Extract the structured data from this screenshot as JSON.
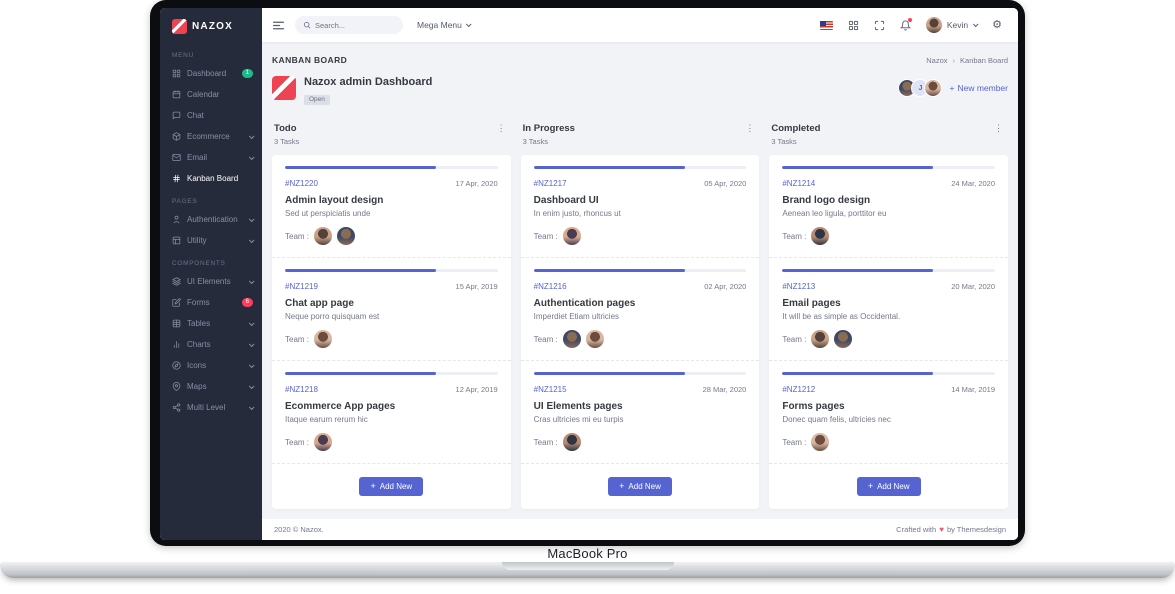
{
  "device_label": "MacBook Pro",
  "brand": "NAZOX",
  "colors": {
    "primary": "#5664d2",
    "sidebar_bg": "#252b3b",
    "success": "#1cbb8c",
    "danger": "#ff3d60",
    "logo_red": "#ee4352"
  },
  "icons": {
    "plus": "+",
    "vertical_dots": "⋮",
    "heart": "♥",
    "breadcrumb_separator": "›",
    "gear": "⚙"
  },
  "sidebar": {
    "sections": [
      {
        "label": "MENU",
        "items": [
          {
            "label": "Dashboard",
            "icon": "dashboard",
            "badge": "1",
            "badge_color": "#1cbb8c"
          },
          {
            "label": "Calendar",
            "icon": "calendar"
          },
          {
            "label": "Chat",
            "icon": "chat"
          },
          {
            "label": "Ecommerce",
            "icon": "ecommerce",
            "chevron": true
          },
          {
            "label": "Email",
            "icon": "email",
            "chevron": true
          },
          {
            "label": "Kanban Board",
            "icon": "kanban",
            "active": true
          }
        ]
      },
      {
        "label": "PAGES",
        "items": [
          {
            "label": "Authentication",
            "icon": "auth",
            "chevron": true
          },
          {
            "label": "Utility",
            "icon": "utility",
            "chevron": true
          }
        ]
      },
      {
        "label": "COMPONENTS",
        "items": [
          {
            "label": "UI Elements",
            "icon": "ui-elements",
            "chevron": true
          },
          {
            "label": "Forms",
            "icon": "forms",
            "badge": "6",
            "badge_color": "#ff3d60"
          },
          {
            "label": "Tables",
            "icon": "tables",
            "chevron": true
          },
          {
            "label": "Charts",
            "icon": "charts",
            "chevron": true
          },
          {
            "label": "Icons",
            "icon": "icons",
            "chevron": true
          },
          {
            "label": "Maps",
            "icon": "maps",
            "chevron": true
          },
          {
            "label": "Multi Level",
            "icon": "multilevel",
            "chevron": true
          }
        ]
      }
    ]
  },
  "topbar": {
    "search_placeholder": "Search...",
    "mega_menu_label": "Mega Menu",
    "user_name": "Kevin"
  },
  "page": {
    "title": "KANBAN BOARD",
    "breadcrumb": {
      "parent": "Nazox",
      "current": "Kanban Board"
    },
    "board": {
      "title": "Nazox admin Dashboard",
      "status_badge": "Open",
      "extra_avatar_initial": "J",
      "new_member_label": "New member"
    }
  },
  "kanban": {
    "columns": [
      {
        "name": "Todo",
        "count": "3 Tasks",
        "add_label": "Add New",
        "cards": [
          {
            "id": "#NZ1220",
            "date": "17 Apr, 2020",
            "title": "Admin layout design",
            "desc": "Sed ut perspiciatis unde",
            "team_label": "Team :",
            "team": 2,
            "progress": 71
          },
          {
            "id": "#NZ1219",
            "date": "15 Apr, 2019",
            "title": "Chat app page",
            "desc": "Neque porro quisquam est",
            "team_label": "Team :",
            "team": 1,
            "progress": 71
          },
          {
            "id": "#NZ1218",
            "date": "12 Apr, 2019",
            "title": "Ecommerce App pages",
            "desc": "Itaque earum rerum hic",
            "team_label": "Team :",
            "team": 1,
            "progress": 71
          }
        ]
      },
      {
        "name": "In Progress",
        "count": "3 Tasks",
        "add_label": "Add New",
        "cards": [
          {
            "id": "#NZ1217",
            "date": "05 Apr, 2020",
            "title": "Dashboard UI",
            "desc": "In enim justo, rhoncus ut",
            "team_label": "Team :",
            "team": 1,
            "progress": 71
          },
          {
            "id": "#NZ1216",
            "date": "02 Apr, 2020",
            "title": "Authentication pages",
            "desc": "Imperdiet Etiam ultricies",
            "team_label": "Team :",
            "team": 2,
            "progress": 71
          },
          {
            "id": "#NZ1215",
            "date": "28 Mar, 2020",
            "title": "UI Elements pages",
            "desc": "Cras ultricies mi eu turpis",
            "team_label": "Team :",
            "team": 1,
            "progress": 71
          }
        ]
      },
      {
        "name": "Completed",
        "count": "3 Tasks",
        "add_label": "Add New",
        "cards": [
          {
            "id": "#NZ1214",
            "date": "24 Mar, 2020",
            "title": "Brand logo design",
            "desc": "Aenean leo ligula, porttitor eu",
            "team_label": "Team :",
            "team": 1,
            "progress": 71
          },
          {
            "id": "#NZ1213",
            "date": "20 Mar, 2020",
            "title": "Email pages",
            "desc": "It will be as simple as Occidental.",
            "team_label": "Team :",
            "team": 2,
            "progress": 71
          },
          {
            "id": "#NZ1212",
            "date": "14 Mar, 2019",
            "title": "Forms pages",
            "desc": "Donec quam felis, ultricies nec",
            "team_label": "Team :",
            "team": 1,
            "progress": 71
          }
        ]
      }
    ]
  },
  "footer": {
    "copyright": "2020 © Nazox.",
    "credit_prefix": "Crafted with",
    "credit_suffix": "by Themesdesign"
  }
}
